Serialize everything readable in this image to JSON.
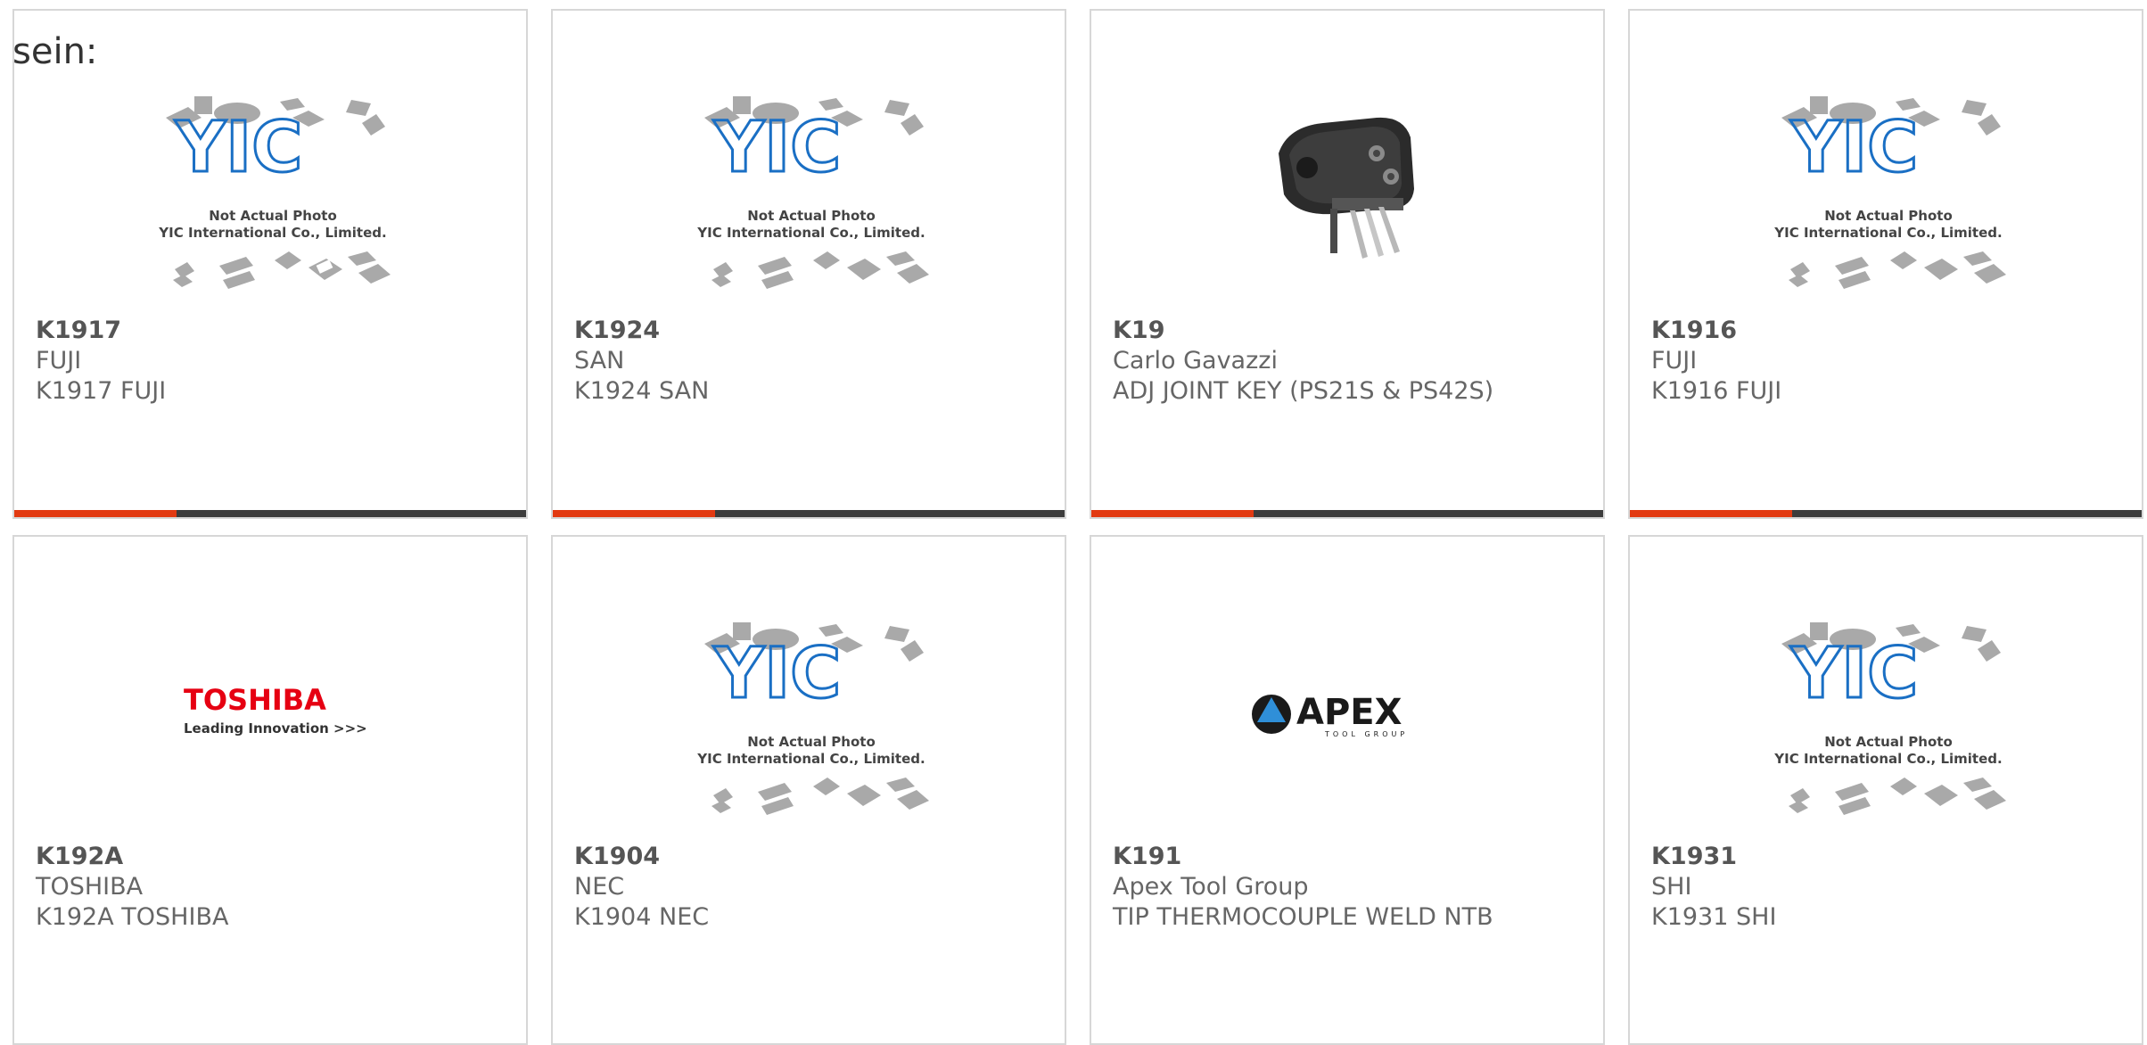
{
  "intro_text": "sein:",
  "placeholder": {
    "line1": "Not Actual Photo",
    "line2": "YIC International Co., Limited.",
    "logo": "YIC"
  },
  "logos": {
    "toshiba_name": "TOSHIBA",
    "toshiba_tagline": "Leading Innovation >>>",
    "apex_name": "APEX",
    "apex_sub": "TOOL GROUP"
  },
  "colors": {
    "accent": "#e23a12",
    "bar": "#3c3c3c",
    "border": "#d7d7d7",
    "text": "#666666",
    "toshiba_red": "#e60012",
    "yic_blue": "#1a6fc4"
  },
  "products": [
    {
      "part": "K1917",
      "maker": "FUJI",
      "desc": "K1917 FUJI",
      "image": "placeholder"
    },
    {
      "part": "K1924",
      "maker": "SAN",
      "desc": "K1924 SAN",
      "image": "placeholder"
    },
    {
      "part": "K19",
      "maker": "Carlo Gavazzi",
      "desc": "ADJ JOINT KEY (PS21S & PS42S)",
      "image": "connector-photo"
    },
    {
      "part": "K1916",
      "maker": "FUJI",
      "desc": "K1916 FUJI",
      "image": "placeholder"
    },
    {
      "part": "K192A",
      "maker": "TOSHIBA",
      "desc": "K192A TOSHIBA",
      "image": "toshiba-logo"
    },
    {
      "part": "K1904",
      "maker": "NEC",
      "desc": "K1904 NEC",
      "image": "placeholder"
    },
    {
      "part": "K191",
      "maker": "Apex Tool Group",
      "desc": "TIP THERMOCOUPLE WELD NTB",
      "image": "apex-logo"
    },
    {
      "part": "K1931",
      "maker": "SHI",
      "desc": "K1931 SHI",
      "image": "placeholder"
    }
  ]
}
